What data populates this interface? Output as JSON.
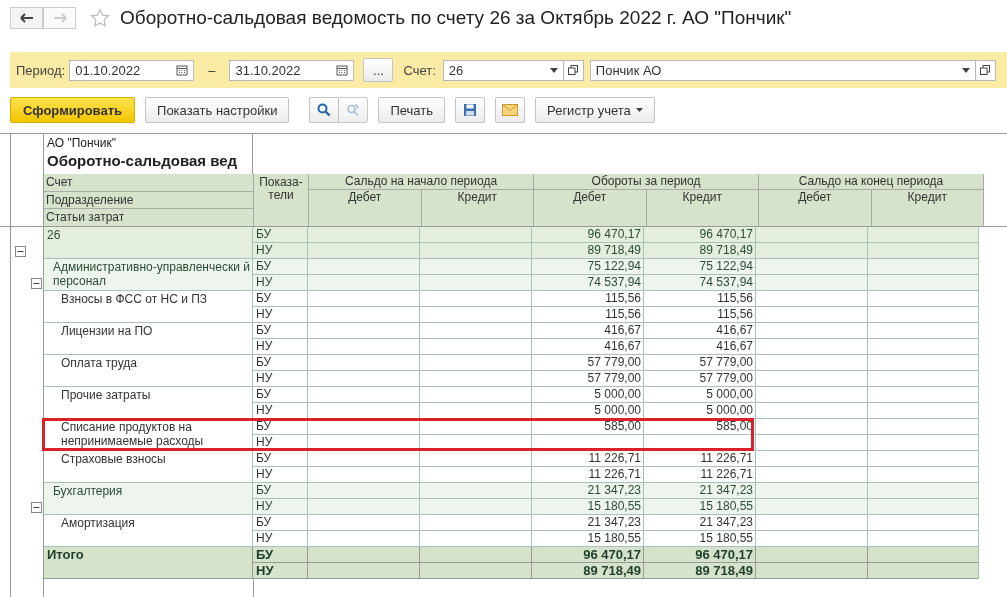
{
  "window": {
    "title": "Оборотно-сальдовая ведомость по счету 26 за Октябрь 2022 г. АО \"Пончик\"",
    "back_enabled": true,
    "forward_enabled": false,
    "favorite": false
  },
  "filters": {
    "period_label": "Период:",
    "date_from": "01.10.2022",
    "dash": "–",
    "date_to": "31.10.2022",
    "more_button": "...",
    "account_label": "Счет:",
    "account": "26",
    "organization": "Пончик АО"
  },
  "toolbar": {
    "generate": "Сформировать",
    "settings": "Показать настройки",
    "print": "Печать",
    "register": "Регистр учета"
  },
  "report": {
    "company": "АО \"Пончик\"",
    "title": "Оборотно-сальдовая вед",
    "grouping_headers": [
      "Счет",
      "Подразделение",
      "Статьи затрат"
    ],
    "indicator_header": "Показа-\nтели",
    "column_groups": [
      {
        "title": "Сальдо на начало периода",
        "columns": [
          "Дебет",
          "Кредит"
        ]
      },
      {
        "title": "Обороты за период",
        "columns": [
          "Дебет",
          "Кредит"
        ]
      },
      {
        "title": "Сальдо на конец периода",
        "columns": [
          "Дебет",
          "Кредит"
        ]
      }
    ],
    "rows": [
      {
        "kind": "account",
        "name": "26",
        "expanded": true,
        "highlighted": false,
        "indicators": [
          {
            "label": "БУ",
            "turnover_debit": "96 470,17",
            "turnover_credit": "96 470,17"
          },
          {
            "label": "НУ",
            "turnover_debit": "89 718,49",
            "turnover_credit": "89 718,49"
          }
        ],
        "children": [
          {
            "kind": "department",
            "name": "Административно-управленчески й персонал",
            "expanded": true,
            "highlighted": false,
            "indicators": [
              {
                "label": "БУ",
                "turnover_debit": "75 122,94",
                "turnover_credit": "75 122,94"
              },
              {
                "label": "НУ",
                "turnover_debit": "74 537,94",
                "turnover_credit": "74 537,94"
              }
            ],
            "children": [
              {
                "kind": "item",
                "name": "Взносы в ФСС от НС и ПЗ",
                "highlighted": false,
                "indicators": [
                  {
                    "label": "БУ",
                    "turnover_debit": "115,56",
                    "turnover_credit": "115,56"
                  },
                  {
                    "label": "НУ",
                    "turnover_debit": "115,56",
                    "turnover_credit": "115,56"
                  }
                ]
              },
              {
                "kind": "item",
                "name": "Лицензии на ПО",
                "highlighted": false,
                "indicators": [
                  {
                    "label": "БУ",
                    "turnover_debit": "416,67",
                    "turnover_credit": "416,67"
                  },
                  {
                    "label": "НУ",
                    "turnover_debit": "416,67",
                    "turnover_credit": "416,67"
                  }
                ]
              },
              {
                "kind": "item",
                "name": "Оплата труда",
                "highlighted": false,
                "indicators": [
                  {
                    "label": "БУ",
                    "turnover_debit": "57 779,00",
                    "turnover_credit": "57 779,00"
                  },
                  {
                    "label": "НУ",
                    "turnover_debit": "57 779,00",
                    "turnover_credit": "57 779,00"
                  }
                ]
              },
              {
                "kind": "item",
                "name": "Прочие затраты",
                "highlighted": false,
                "indicators": [
                  {
                    "label": "БУ",
                    "turnover_debit": "5 000,00",
                    "turnover_credit": "5 000,00"
                  },
                  {
                    "label": "НУ",
                    "turnover_debit": "5 000,00",
                    "turnover_credit": "5 000,00"
                  }
                ]
              },
              {
                "kind": "item",
                "name": "Списание продуктов на непринимаемые расходы",
                "highlighted": true,
                "indicators": [
                  {
                    "label": "БУ",
                    "turnover_debit": "585,00",
                    "turnover_credit": "585,00"
                  },
                  {
                    "label": "НУ"
                  }
                ]
              },
              {
                "kind": "item",
                "name": "Страховые взносы",
                "highlighted": false,
                "indicators": [
                  {
                    "label": "БУ",
                    "turnover_debit": "11 226,71",
                    "turnover_credit": "11 226,71"
                  },
                  {
                    "label": "НУ",
                    "turnover_debit": "11 226,71",
                    "turnover_credit": "11 226,71"
                  }
                ]
              }
            ]
          },
          {
            "kind": "department",
            "name": "Бухгалтерия",
            "expanded": true,
            "highlighted": false,
            "indicators": [
              {
                "label": "БУ",
                "turnover_debit": "21 347,23",
                "turnover_credit": "21 347,23"
              },
              {
                "label": "НУ",
                "turnover_debit": "15 180,55",
                "turnover_credit": "15 180,55"
              }
            ],
            "children": [
              {
                "kind": "item",
                "name": "Амортизация",
                "highlighted": false,
                "indicators": [
                  {
                    "label": "БУ",
                    "turnover_debit": "21 347,23",
                    "turnover_credit": "21 347,23"
                  },
                  {
                    "label": "НУ",
                    "turnover_debit": "15 180,55",
                    "turnover_credit": "15 180,55"
                  }
                ]
              }
            ]
          }
        ]
      },
      {
        "kind": "total",
        "name": "Итого",
        "highlighted": false,
        "indicators": [
          {
            "label": "БУ",
            "turnover_debit": "96 470,17",
            "turnover_credit": "96 470,17"
          },
          {
            "label": "НУ",
            "turnover_debit": "89 718,49",
            "turnover_credit": "89 718,49"
          }
        ]
      }
    ]
  }
}
